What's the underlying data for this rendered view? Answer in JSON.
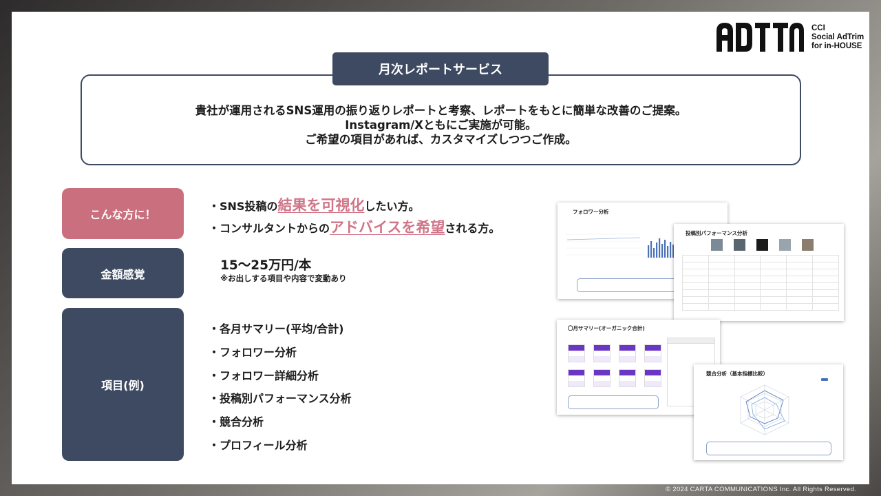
{
  "brand": {
    "logo_text": [
      "CCI",
      "Social AdTrim",
      "for in-HOUSE"
    ]
  },
  "service": {
    "title": "月次レポートサービス",
    "description": [
      "貴社が運用されるSNS運用の振り返りレポートと考察、レポートをもとに簡単な改善のご提案。",
      "Instagram/Xともにご実施が可能。",
      "ご希望の項目があれば、カスタマイズしつつご作成。"
    ]
  },
  "target": {
    "label": "こんな方に！",
    "lines": [
      {
        "pre": "・SNS投稿の",
        "highlight": "結果を可視化",
        "post": "したい方。"
      },
      {
        "pre": "・コンサルタントからの",
        "highlight": "アドバイスを希望",
        "post": "される方。"
      }
    ]
  },
  "price": {
    "label": "金額感覚",
    "value": "15〜25万円/本",
    "note": "※お出しする項目や内容で変動あり"
  },
  "items": {
    "label": "項目(例)",
    "list": [
      "・各月サマリー(平均/合計)",
      "・フォロワー分析",
      "・フォロワー詳細分析",
      "・投稿別パフォーマンス分析",
      "・競合分析",
      "・プロフィール分析"
    ]
  },
  "thumbnails": {
    "follower_analysis": "フォロワー分析",
    "post_performance": "投稿別パフォーマンス分析",
    "monthly_summary": "〇月サマリー(オーガニック合計)",
    "competitor_analysis": "競合分析（基本指標比較）"
  },
  "footer": "© 2024 CARTA COMMUNICATIONS Inc.  All Rights Reserved.",
  "colors": {
    "navy": "#3e4a62",
    "pink": "#c96f7e",
    "highlight": "#d07588"
  }
}
